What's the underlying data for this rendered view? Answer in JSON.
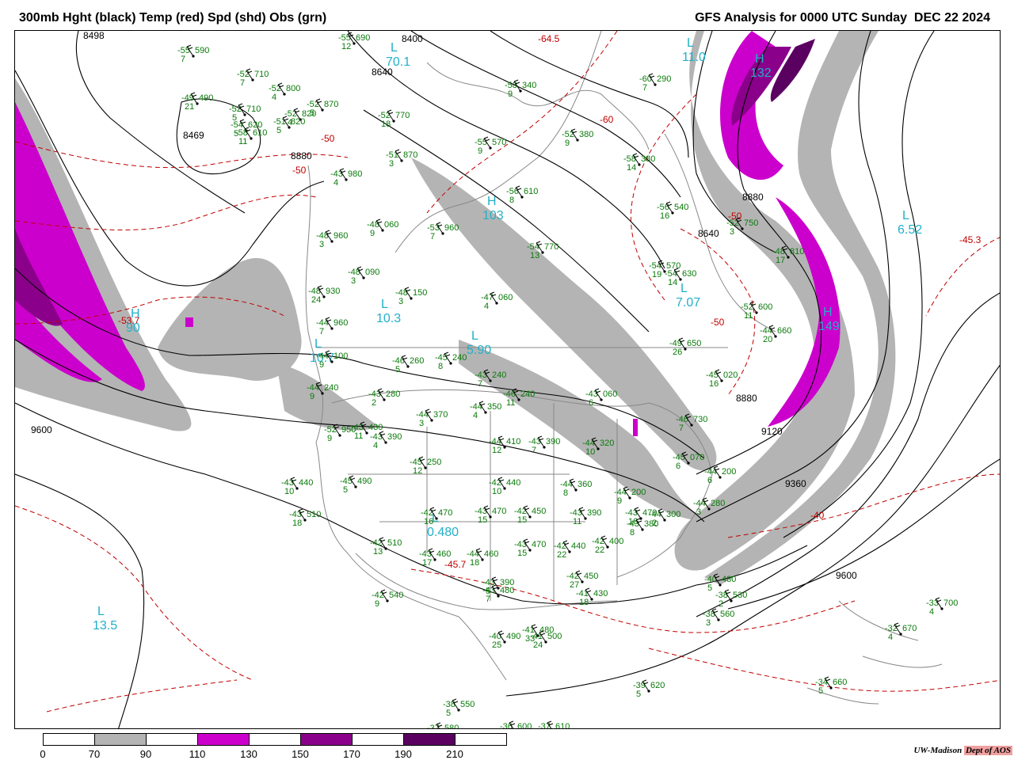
{
  "header": {
    "left_title": "300mb Hght (black) Temp (red) Spd (shd) Obs (grn)",
    "right_title": "GFS Analysis for 0000 UTC Sunday  DEC 22 2024"
  },
  "colors": {
    "height_contour": "#000000",
    "temperature_contour": "#c00000",
    "observations": "#0a7a0a",
    "pressure_systems": "#22b0c8",
    "speed_70_90": "#b4b4b4",
    "speed_110_130": "#cc00cc",
    "speed_150_170": "#8a008a",
    "speed_190_210": "#5a0060"
  },
  "legend": {
    "labels": [
      "0",
      "70",
      "90",
      "110",
      "130",
      "150",
      "170",
      "190",
      "210"
    ],
    "fills": [
      "#ffffff",
      "#b4b4b4",
      "#ffffff",
      "#cc00cc",
      "#ffffff",
      "#8a008a",
      "#ffffff",
      "#5a0060",
      "#ffffff"
    ]
  },
  "credit": {
    "org": "UW-Madison",
    "dept": "Dept of AOS"
  },
  "height_labels": [
    "8498",
    "8400",
    "8640",
    "8469",
    "8880",
    "8880",
    "8640",
    "8880",
    "9120",
    "9360",
    "9600",
    "9600"
  ],
  "temperature_labels": [
    "-64.5",
    "-60",
    "-50",
    "-50",
    "-50",
    "-45.3",
    "-50",
    "-53.7",
    "-40",
    "-45.7"
  ],
  "systems": [
    {
      "type": "L",
      "value": "11.0"
    },
    {
      "type": "H",
      "value": "132"
    },
    {
      "type": "L",
      "value": "70.1"
    },
    {
      "type": "L",
      "value": "6.52"
    },
    {
      "type": "L",
      "value": "7.07"
    },
    {
      "type": "H",
      "value": "103"
    },
    {
      "type": "L",
      "value": "10.3"
    },
    {
      "type": "L",
      "value": "5.90"
    },
    {
      "type": "L",
      "value": "10.7"
    },
    {
      "type": "H",
      "value": "149"
    },
    {
      "type": "H",
      "value": "90"
    },
    {
      "type": "L",
      "value": "0.480"
    },
    {
      "type": "L",
      "value": "13.5"
    }
  ],
  "observations": [
    {
      "temp": "-55",
      "dew": "7",
      "hgt": "590"
    },
    {
      "temp": "-52",
      "dew": "7",
      "hgt": "710"
    },
    {
      "temp": "-52",
      "dew": "4",
      "hgt": "800"
    },
    {
      "temp": "-55",
      "dew": "12",
      "hgt": "690"
    },
    {
      "temp": "-49",
      "dew": "21",
      "hgt": "490"
    },
    {
      "temp": "-52",
      "dew": "5",
      "hgt": "710"
    },
    {
      "temp": "-52",
      "dew": "4",
      "hgt": "820"
    },
    {
      "temp": "-52",
      "dew": "5",
      "hgt": "870"
    },
    {
      "temp": "-54",
      "dew": "5",
      "hgt": "620"
    },
    {
      "temp": "-51",
      "dew": "5",
      "hgt": "820"
    },
    {
      "temp": "-52",
      "dew": "18",
      "hgt": "770"
    },
    {
      "temp": "-58",
      "dew": "11",
      "hgt": "610"
    },
    {
      "temp": "-51",
      "dew": "3",
      "hgt": "870"
    },
    {
      "temp": "-55",
      "dew": "9",
      "hgt": "570"
    },
    {
      "temp": "-43",
      "dew": "4",
      "hgt": "980"
    },
    {
      "temp": "-48",
      "dew": "9",
      "hgt": "060"
    },
    {
      "temp": "-53",
      "dew": "7",
      "hgt": "960"
    },
    {
      "temp": "-56",
      "dew": "8",
      "hgt": "610"
    },
    {
      "temp": "-48",
      "dew": "3",
      "hgt": "960"
    },
    {
      "temp": "-48",
      "dew": "3",
      "hgt": "090"
    },
    {
      "temp": "-48",
      "dew": "3",
      "hgt": "150"
    },
    {
      "temp": "-48",
      "dew": "24",
      "hgt": "930"
    },
    {
      "temp": "-47",
      "dew": "4",
      "hgt": "060"
    },
    {
      "temp": "-54",
      "dew": "13",
      "hgt": "770"
    },
    {
      "temp": "-54",
      "dew": "19",
      "hgt": "570"
    },
    {
      "temp": "-54",
      "dew": "14",
      "hgt": "630"
    },
    {
      "temp": "-52",
      "dew": "3",
      "hgt": "750"
    },
    {
      "temp": "-56",
      "dew": "16",
      "hgt": "540"
    },
    {
      "temp": "-58",
      "dew": "14",
      "hgt": "380"
    },
    {
      "temp": "-60",
      "dew": "7",
      "hgt": "290"
    },
    {
      "temp": "-52",
      "dew": "9",
      "hgt": "380"
    },
    {
      "temp": "-58",
      "dew": "9",
      "hgt": "340"
    },
    {
      "temp": "-44",
      "dew": "7",
      "hgt": "960"
    },
    {
      "temp": "-44",
      "dew": "9",
      "hgt": "100"
    },
    {
      "temp": "-46",
      "dew": "5",
      "hgt": "260"
    },
    {
      "temp": "-45",
      "dew": "8",
      "hgt": "240"
    },
    {
      "temp": "-49",
      "dew": "26",
      "hgt": "650"
    },
    {
      "temp": "-52",
      "dew": "11",
      "hgt": "600"
    },
    {
      "temp": "-44",
      "dew": "20",
      "hgt": "660"
    },
    {
      "temp": "-48",
      "dew": "17",
      "hgt": "810"
    },
    {
      "temp": "-44",
      "dew": "9",
      "hgt": "240"
    },
    {
      "temp": "-43",
      "dew": "2",
      "hgt": "280"
    },
    {
      "temp": "-44",
      "dew": "3",
      "hgt": "370"
    },
    {
      "temp": "-44",
      "dew": "4",
      "hgt": "350"
    },
    {
      "temp": "-43",
      "dew": "7",
      "hgt": "240"
    },
    {
      "temp": "-46",
      "dew": "11",
      "hgt": "240"
    },
    {
      "temp": "-43",
      "dew": "6",
      "hgt": "060"
    },
    {
      "temp": "-45",
      "dew": "16",
      "hgt": "020"
    },
    {
      "temp": "-46",
      "dew": "7",
      "hgt": "730"
    },
    {
      "temp": "-52",
      "dew": "9",
      "hgt": "950"
    },
    {
      "temp": "-43",
      "dew": "11",
      "hgt": "430"
    },
    {
      "temp": "-43",
      "dew": "4",
      "hgt": "390"
    },
    {
      "temp": "-44",
      "dew": "12",
      "hgt": "410"
    },
    {
      "temp": "-43",
      "dew": "7",
      "hgt": "390"
    },
    {
      "temp": "-44",
      "dew": "10",
      "hgt": "320"
    },
    {
      "temp": "-44",
      "dew": "9",
      "hgt": "200"
    },
    {
      "temp": "-45",
      "dew": "12",
      "hgt": "250"
    },
    {
      "temp": "-43",
      "dew": "10",
      "hgt": "440"
    },
    {
      "temp": "-45",
      "dew": "5",
      "hgt": "490"
    },
    {
      "temp": "-43",
      "dew": "16",
      "hgt": "470"
    },
    {
      "temp": "-42",
      "dew": "10",
      "hgt": "440"
    },
    {
      "temp": "-44",
      "dew": "8",
      "hgt": "360"
    },
    {
      "temp": "-45",
      "dew": "6",
      "hgt": "070"
    },
    {
      "temp": "-44",
      "dew": "6",
      "hgt": "200"
    },
    {
      "temp": "-43",
      "dew": "18",
      "hgt": "510"
    },
    {
      "temp": "-42",
      "dew": "16",
      "hgt": "470"
    },
    {
      "temp": "-43",
      "dew": "15",
      "hgt": "470"
    },
    {
      "temp": "-42",
      "dew": "15",
      "hgt": "450"
    },
    {
      "temp": "-43",
      "dew": "11",
      "hgt": "390"
    },
    {
      "temp": "-43",
      "dew": "8",
      "hgt": "380"
    },
    {
      "temp": "-44",
      "dew": "2",
      "hgt": "300"
    },
    {
      "temp": "-44",
      "dew": "3",
      "hgt": "280"
    },
    {
      "temp": "-42",
      "dew": "13",
      "hgt": "510"
    },
    {
      "temp": "-43",
      "dew": "17",
      "hgt": "460"
    },
    {
      "temp": "-44",
      "dew": "18",
      "hgt": "460"
    },
    {
      "temp": "-43",
      "dew": "15",
      "hgt": "470"
    },
    {
      "temp": "-42",
      "dew": "22",
      "hgt": "440"
    },
    {
      "temp": "-42",
      "dew": "22",
      "hgt": "400"
    },
    {
      "temp": "-43",
      "dew": "5",
      "hgt": "390"
    },
    {
      "temp": "-42",
      "dew": "9",
      "hgt": "540"
    },
    {
      "temp": "-43",
      "dew": "7",
      "hgt": "480"
    },
    {
      "temp": "-42",
      "dew": "27",
      "hgt": "450"
    },
    {
      "temp": "-41",
      "dew": "18",
      "hgt": "430"
    },
    {
      "temp": "-40",
      "dew": "5",
      "hgt": "480"
    },
    {
      "temp": "-38",
      "dew": "2",
      "hgt": "530"
    },
    {
      "temp": "-38",
      "dew": "3",
      "hgt": "560"
    },
    {
      "temp": "-41",
      "dew": "33",
      "hgt": "480"
    },
    {
      "temp": "-40",
      "dew": "25",
      "hgt": "490"
    },
    {
      "temp": "-41",
      "dew": "24",
      "hgt": "500"
    },
    {
      "temp": "-39",
      "dew": "5",
      "hgt": "620"
    },
    {
      "temp": "-38",
      "dew": "5",
      "hgt": "550"
    },
    {
      "temp": "-37",
      "dew": "",
      "hgt": "580"
    },
    {
      "temp": "-36",
      "dew": "",
      "hgt": "600"
    },
    {
      "temp": "-37",
      "dew": "",
      "hgt": "610"
    },
    {
      "temp": "-34",
      "dew": "5",
      "hgt": "660"
    },
    {
      "temp": "-33",
      "dew": "4",
      "hgt": "700"
    },
    {
      "temp": "-32",
      "dew": "4",
      "hgt": "670"
    }
  ]
}
